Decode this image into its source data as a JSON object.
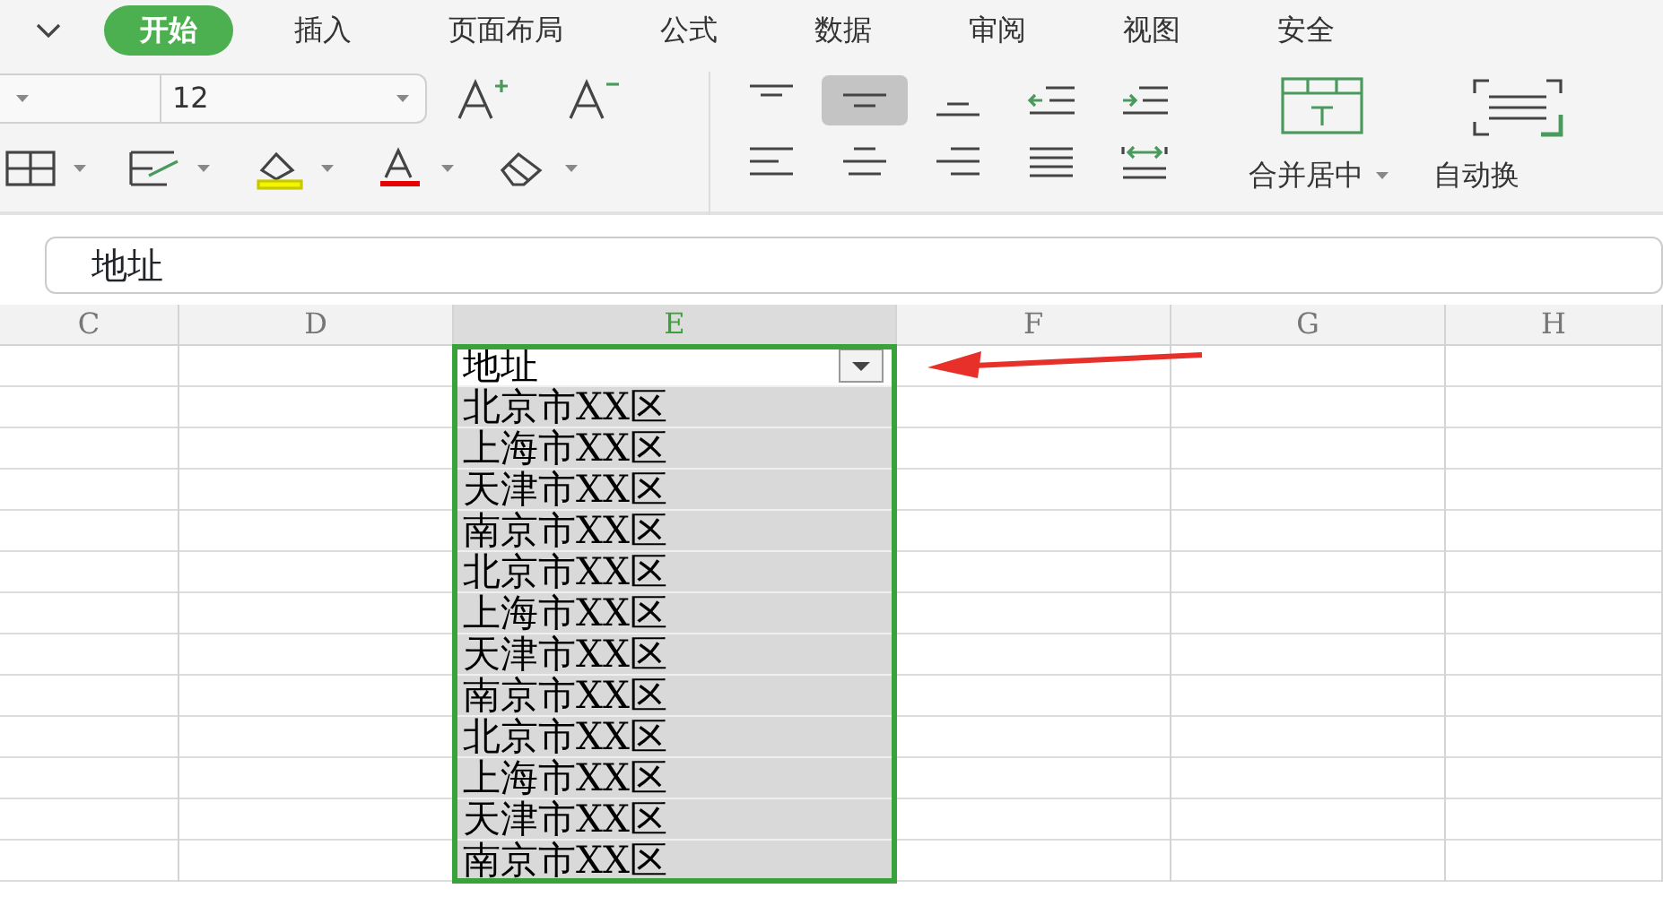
{
  "ribbon_tabs": [
    {
      "label": "开始",
      "selected": true
    },
    {
      "label": "插入",
      "selected": false
    },
    {
      "label": "页面布局",
      "selected": false
    },
    {
      "label": "公式",
      "selected": false
    },
    {
      "label": "数据",
      "selected": false
    },
    {
      "label": "审阅",
      "selected": false
    },
    {
      "label": "视图",
      "selected": false
    },
    {
      "label": "安全",
      "selected": false
    }
  ],
  "toolbar": {
    "font_size": "12",
    "vertical_align": [
      {
        "kind": "top",
        "selected": false
      },
      {
        "kind": "middle",
        "selected": true
      },
      {
        "kind": "bottom",
        "selected": false
      }
    ],
    "merge_label": "合并居中",
    "wrap_label": "自动换"
  },
  "formula_bar": {
    "value": "地址"
  },
  "columns": [
    {
      "label": "C",
      "selected": false
    },
    {
      "label": "D",
      "selected": false
    },
    {
      "label": "E",
      "selected": true
    },
    {
      "label": "F",
      "selected": false
    },
    {
      "label": "G",
      "selected": false
    },
    {
      "label": "H",
      "selected": false
    }
  ],
  "column_e": {
    "header": "地址",
    "filter": true,
    "values": [
      "北京市XX区",
      "上海市XX区",
      "天津市XX区",
      "南京市XX区",
      "北京市XX区",
      "上海市XX区",
      "天津市XX区",
      "南京市XX区",
      "北京市XX区",
      "上海市XX区",
      "天津市XX区",
      "南京市XX区"
    ]
  }
}
